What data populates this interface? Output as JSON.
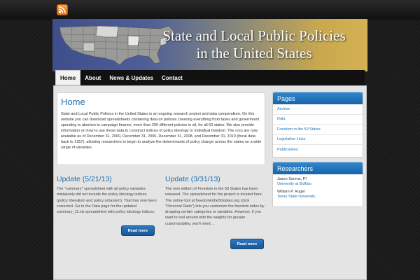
{
  "banner": {
    "title_line1": "State and Local Public Policies",
    "title_line2": "in the United States"
  },
  "nav": [
    {
      "label": "Home",
      "active": true
    },
    {
      "label": "About",
      "active": false
    },
    {
      "label": "News & Updates",
      "active": false
    },
    {
      "label": "Contact",
      "active": false
    }
  ],
  "home": {
    "title": "Home",
    "text_before_link": "State and Local Public Policies in the United States is an ongoing research project and data compendium. On this website you can download spreadsheets containing data on policies covering everything from taxes and government spending to abortion to campaign finance, more than 200 different policies in all, for all 50 states. We also provide information on how to use these data to construct indices of policy ideology or individual freedom. The",
    "link_text": "data",
    "text_after_link": "are now available as of December 31, 2000, December 31, 2006, December 31, 2008, and December 31, 2010 (fiscal data back to 1957), allowing researchers to begin to analyze the determinants of policy change across the states on a wide range of variables."
  },
  "updates": [
    {
      "title": "Update (5/21/13)",
      "text": "The \"summary\" spreadsheet with all policy variables mistakenly did not include the policy ideology indices (policy liberalism and policy urbanism). That has now been corrected. Go to the Data page for the updated summary_11.xls spreadsheet with policy ideology indices.",
      "button": "Read more"
    },
    {
      "title": "Update (3/31/13)",
      "text": "The new edition of Freedom in the 50 States has been released. The spreadsheet for the project is located here. The online tool at freedominthe50states.org (click \"Personal Rank\") lets you customize the freedom index by dropping certain categories or variables. However, if you want to tool around with the weights for greater customizability, you'll need ...",
      "button": "Read more"
    }
  ],
  "sidebar": {
    "pages_title": "Pages",
    "pages": [
      "Archive",
      "Data",
      "Freedom in the 50 States",
      "Legislative Links",
      "Publications"
    ],
    "researchers_title": "Researchers",
    "researchers": [
      {
        "name": "Jason Sorens, PI",
        "affiliation": "University at Buffalo"
      },
      {
        "name": "William P. Ruger",
        "affiliation": "Texas State University"
      }
    ]
  },
  "icons": {
    "rss": "rss-feed-icon",
    "map": "us-map-image"
  },
  "colors": {
    "accent": "#1e71b5",
    "nav_bg": "#111111",
    "rss": "#f08a2c"
  }
}
